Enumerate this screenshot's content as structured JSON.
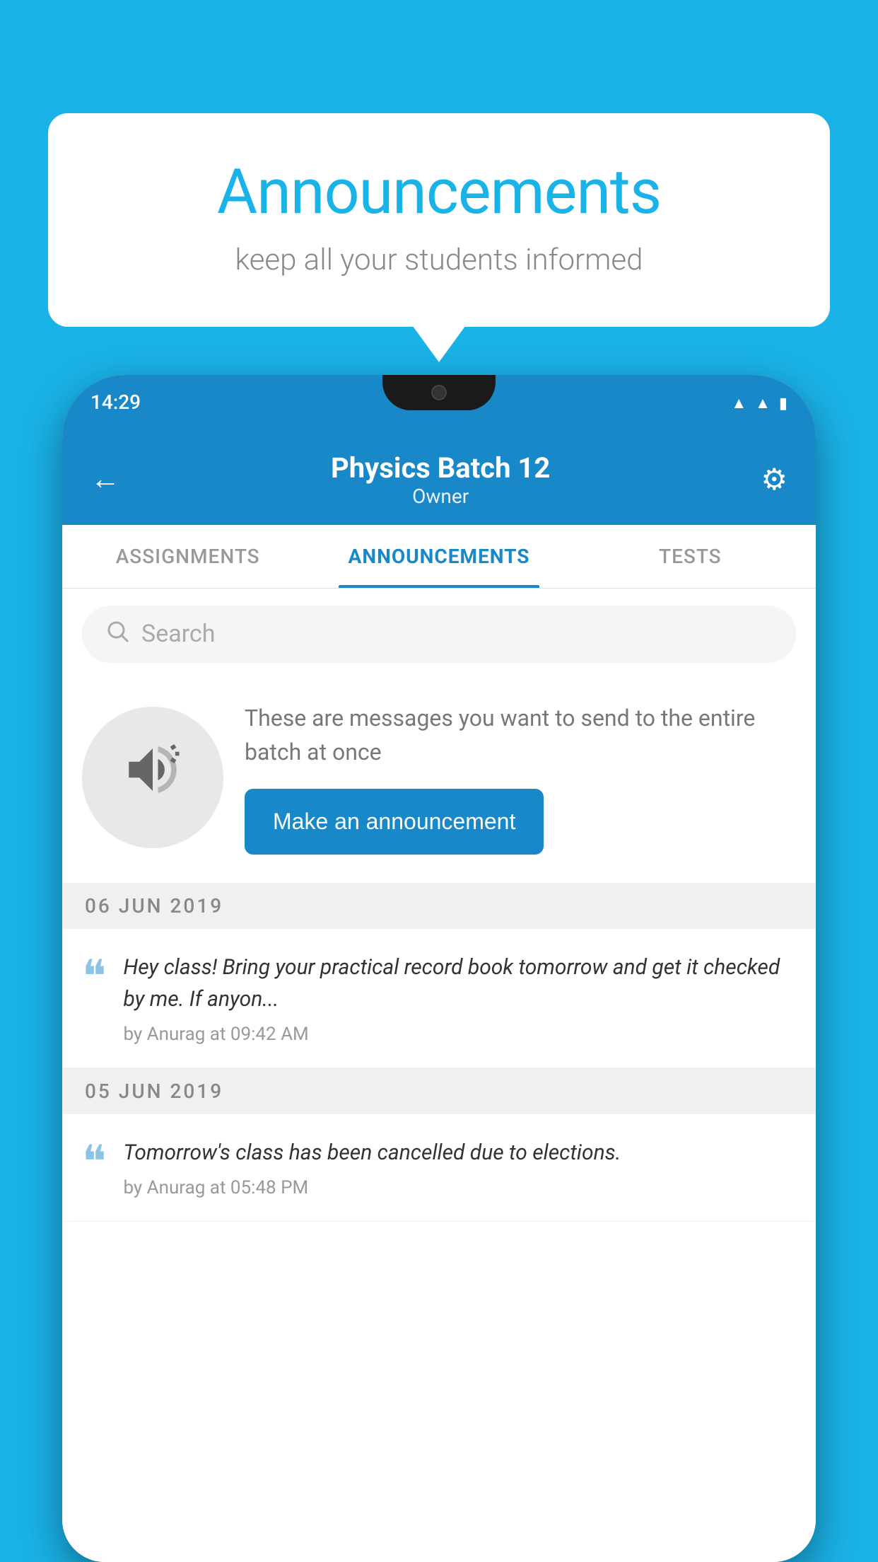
{
  "background_color": "#1ab3e8",
  "bubble": {
    "title": "Announcements",
    "subtitle": "keep all your students informed"
  },
  "phone": {
    "status_bar": {
      "time": "14:29"
    },
    "header": {
      "title": "Physics Batch 12",
      "subtitle": "Owner",
      "back_label": "←",
      "gear_label": "⚙"
    },
    "tabs": [
      {
        "label": "ASSIGNMENTS",
        "active": false
      },
      {
        "label": "ANNOUNCEMENTS",
        "active": true
      },
      {
        "label": "TESTS",
        "active": false
      }
    ],
    "search": {
      "placeholder": "Search"
    },
    "promo": {
      "description": "These are messages you want to send to the entire batch at once",
      "button_label": "Make an announcement"
    },
    "dates": [
      {
        "date_label": "06  JUN  2019",
        "announcements": [
          {
            "message": "Hey class! Bring your practical record book tomorrow and get it checked by me. If anyon...",
            "author": "by Anurag at 09:42 AM"
          }
        ]
      },
      {
        "date_label": "05  JUN  2019",
        "announcements": [
          {
            "message": "Tomorrow's class has been cancelled due to elections.",
            "author": "by Anurag at 05:48 PM"
          }
        ]
      }
    ]
  }
}
